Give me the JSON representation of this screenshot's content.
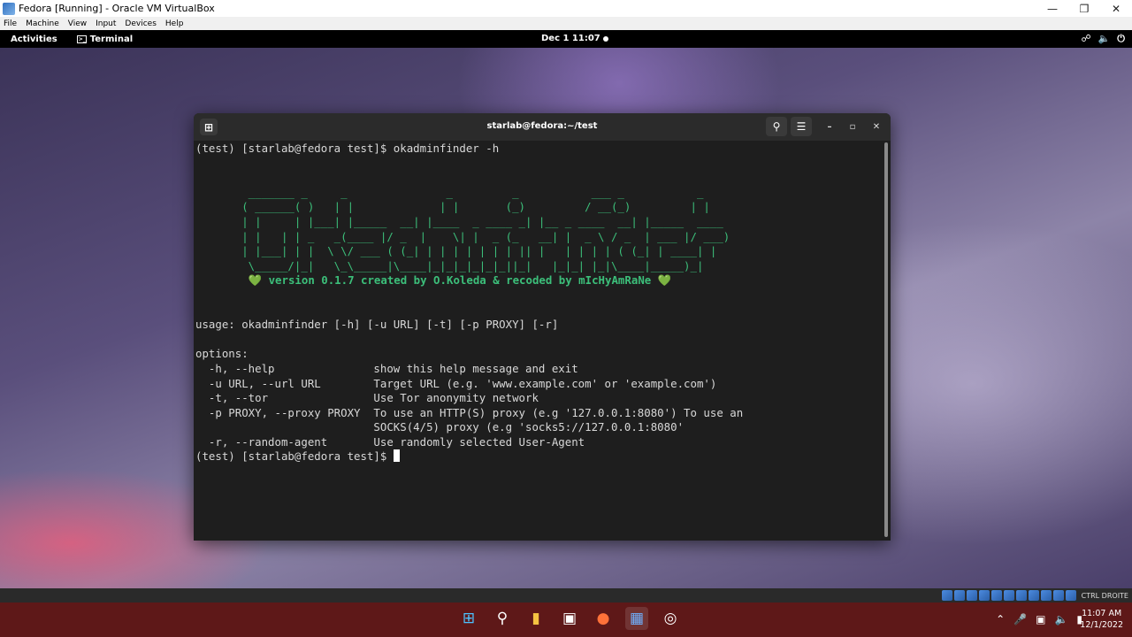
{
  "host_window": {
    "title": "Fedora [Running] - Oracle VM VirtualBox",
    "menu": [
      "File",
      "Machine",
      "View",
      "Input",
      "Devices",
      "Help"
    ]
  },
  "gnome_topbar": {
    "activities": "Activities",
    "app_name": "Terminal",
    "clock": "Dec 1  11:07"
  },
  "terminal": {
    "title": "starlab@fedora:~/test",
    "lines": {
      "cmd": "(test) [starlab@fedora test]$ okadminfinder -h",
      "b1": "        _______ _     _               _         _           ___ _           _",
      "b2": "       ( ______( )   | |             | |       (_)         / __(_)         | |",
      "b3": "       | |     | |___| |_____  __| |____  _ ____ _| |__ _ ____  __| |_____  ____",
      "b4": "       | |   | | _   _(____ |/ _  |    \\| |  _ (_   __| |  _ \\ / _  | ___ |/ ___)",
      "b5": "       | |___| | |  \\ \\/ ___ ( (_| | | | | | | | || |   | | | | ( (_| | ____| |",
      "b6": "        \\_____/|_|   \\_\\_____|\\____|_|_|_|_|_|_||_|   |_|_| |_|\\____|_____)_|",
      "version": "        💚 version 0.1.7 created by O.Koleda & recoded by mIcHyAmRaNe 💚",
      "usage": "usage: okadminfinder [-h] [-u URL] [-t] [-p PROXY] [-r]",
      "options_header": "options:",
      "opt_h": "  -h, --help               show this help message and exit",
      "opt_u": "  -u URL, --url URL        Target URL (e.g. 'www.example.com' or 'example.com')",
      "opt_t": "  -t, --tor                Use Tor anonymity network",
      "opt_p1": "  -p PROXY, --proxy PROXY  To use an HTTP(S) proxy (e.g '127.0.0.1:8080') To use an",
      "opt_p2": "                           SOCKS(4/5) proxy (e.g 'socks5://127.0.0.1:8080'",
      "opt_r": "  -r, --random-agent       Use randomly selected User-Agent",
      "prompt": "(test) [starlab@fedora test]$ "
    }
  },
  "vbox_status": {
    "host_key": "CTRL DROITE"
  },
  "taskbar": {
    "time": "11:07 AM",
    "date": "12/1/2022"
  }
}
